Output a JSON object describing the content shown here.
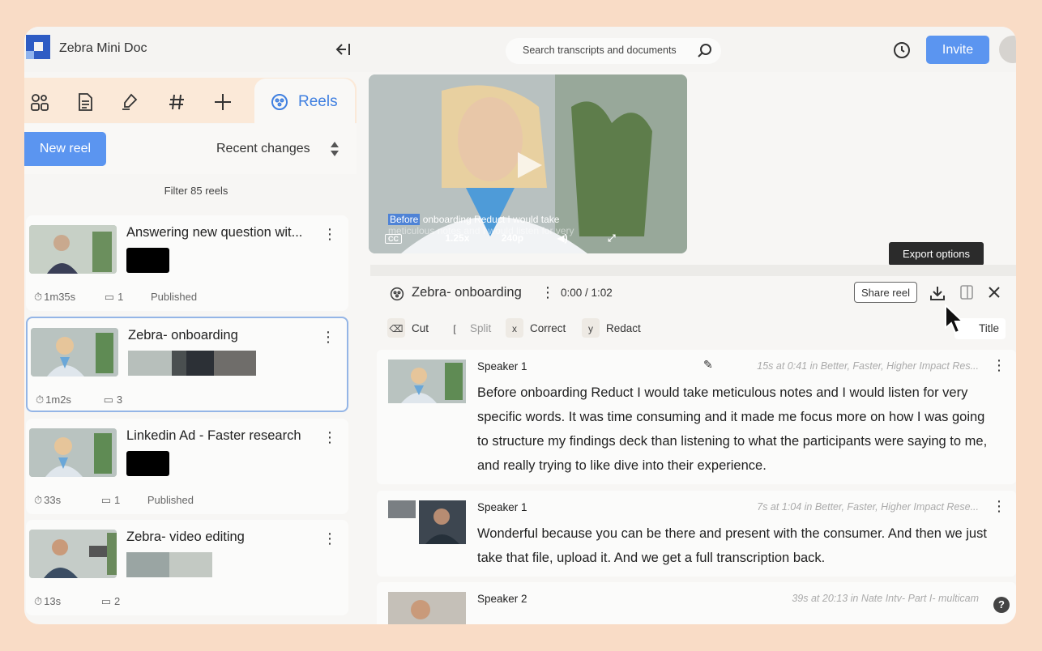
{
  "app": {
    "title": "Zebra Mini Doc"
  },
  "search": {
    "placeholder": "Search transcripts and documents"
  },
  "header": {
    "invite_label": "Invite"
  },
  "tabs": {
    "reels_label": "Reels"
  },
  "reels_panel": {
    "new_reel_label": "New reel",
    "sort_label": "Recent changes",
    "filter_label": "Filter 85 reels",
    "items": [
      {
        "title": "Answering new question wit...",
        "duration": "1m35s",
        "clips": "1",
        "status": "Published"
      },
      {
        "title": "Zebra- onboarding",
        "duration": "1m2s",
        "clips": "3",
        "status": ""
      },
      {
        "title": "Linkedin Ad - Faster research",
        "duration": "33s",
        "clips": "1",
        "status": "Published"
      },
      {
        "title": "Zebra- video editing",
        "duration": "13s",
        "clips": "2",
        "status": ""
      }
    ]
  },
  "video": {
    "caption_highlight": "Before",
    "caption_rest": " onboarding Reduct I would take",
    "caption_line2": "meticulous notes and I would listen for very",
    "speed": "1.25x",
    "quality": "240p",
    "cc_label": "CC"
  },
  "editor": {
    "reel_name": "Zebra- onboarding",
    "timecode": "0:00 / 1:02",
    "share_label": "Share reel",
    "export_tooltip": "Export options",
    "tools": [
      {
        "key": "⌫",
        "label": "Cut"
      },
      {
        "key": "[",
        "label": "Split"
      },
      {
        "key": "x",
        "label": "Correct"
      },
      {
        "key": "y",
        "label": "Redact"
      }
    ],
    "title_label": "Title"
  },
  "transcript": [
    {
      "speaker": "Speaker 1",
      "source": "15s at 0:41 in Better, Faster, Higher Impact Res...",
      "text": "Before onboarding Reduct I would take meticulous notes and I would listen for very specific words. It was time consuming and it made me focus more on how I was going to structure my findings deck than listening to what the participants were saying to me, and really trying to like dive into their experience."
    },
    {
      "speaker": "Speaker 1",
      "source": "7s at 1:04 in Better, Faster, Higher Impact Rese...",
      "text": "Wonderful because you can be there and present with the consumer. And then we just take that file, upload it. And we get a full transcription back."
    },
    {
      "speaker": "Speaker 2",
      "source": "39s at 20:13 in Nate Intv- Part I- multicam",
      "text": ""
    }
  ],
  "colors": {
    "accent": "#5b95f0",
    "background": "#f9dcc6",
    "reels_tab": "#3f7fe0"
  }
}
